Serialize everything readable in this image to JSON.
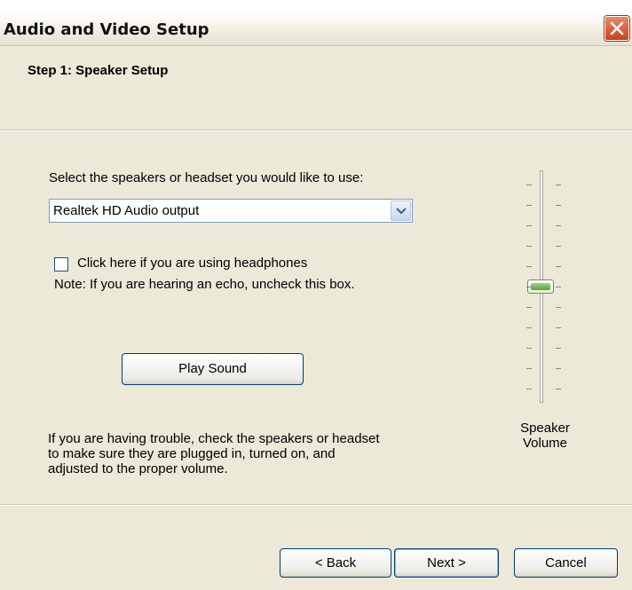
{
  "window": {
    "title": "Audio and Video Setup",
    "close_icon": "close-icon"
  },
  "step": {
    "title": "Step 1: Speaker Setup"
  },
  "device": {
    "label": "Select the speakers or headset you would like to use:",
    "selected": "Realtek HD Audio output"
  },
  "headphones": {
    "checkbox_label": "Click here if you are using headphones",
    "checked": false,
    "note": "Note: If you are hearing an echo, uncheck this box."
  },
  "play_sound_label": "Play Sound",
  "trouble_text": [
    "If you are having trouble, check the speakers or headset",
    "to make sure they are plugged in, turned on, and",
    "adjusted to the proper volume."
  ],
  "volume": {
    "label_line1": "Speaker",
    "label_line2": "Volume",
    "level": 0.5
  },
  "buttons": {
    "back": "< Back",
    "next": "Next >",
    "cancel": "Cancel"
  },
  "colors": {
    "window_bg": "#ece9d8",
    "close_button": "#c9421c",
    "button_border": "#003c74"
  }
}
